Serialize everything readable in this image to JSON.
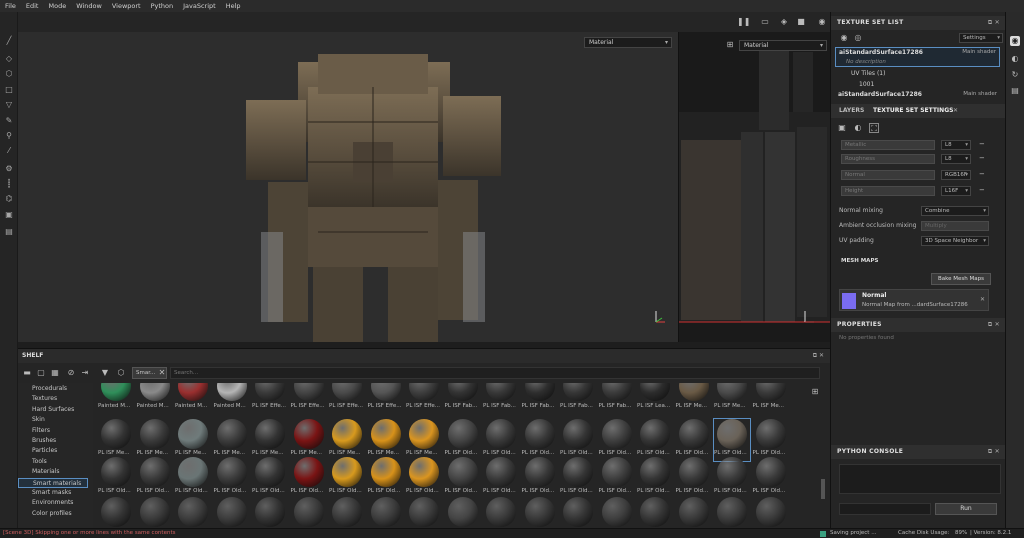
{
  "menu": [
    "File",
    "Edit",
    "Mode",
    "Window",
    "Viewport",
    "Python",
    "JavaScript",
    "Help"
  ],
  "viewport3d": {
    "mode": "Material"
  },
  "viewport2d": {
    "mode": "Material"
  },
  "texture_set_list": {
    "title": "TEXTURE SET LIST",
    "settings_label": "Settings",
    "sets": [
      {
        "name": "aiStandardSurface17286",
        "shader": "Main shader",
        "description": "No description",
        "uv_tiles": "UV Tiles (1)",
        "tile": "1001"
      },
      {
        "name": "aiStandardSurface17286",
        "shader": "Main shader"
      }
    ]
  },
  "tabs": {
    "layers": "LAYERS",
    "settings": "TEXTURE SET SETTINGS"
  },
  "channels": [
    {
      "name": "Metallic",
      "format": "L8"
    },
    {
      "name": "Roughness",
      "format": "L8"
    },
    {
      "name": "Normal",
      "format": "RGB16F"
    },
    {
      "name": "Height",
      "format": "L16F"
    }
  ],
  "mixing": [
    {
      "label": "Normal mixing",
      "value": "Combine"
    },
    {
      "label": "Ambient occlusion mixing",
      "value": "Multiply"
    },
    {
      "label": "UV padding",
      "value": "3D Space Neighbor"
    }
  ],
  "mesh_maps": {
    "title": "MESH MAPS",
    "bake_label": "Bake Mesh Maps",
    "map_name": "Normal",
    "map_desc": "Normal Map from ...dardSurface17286"
  },
  "properties": {
    "title": "PROPERTIES",
    "empty": "No properties found"
  },
  "python_console": {
    "title": "PYTHON CONSOLE",
    "run_label": "Run"
  },
  "shelf": {
    "title": "SHELF",
    "filter_tag": "Smar...",
    "search_placeholder": "Search...",
    "categories": [
      "Procedurals",
      "Textures",
      "Hard Surfaces",
      "Skin",
      "Filters",
      "Brushes",
      "Particles",
      "Tools",
      "Materials",
      "Smart materials",
      "Smart masks",
      "Environments",
      "Color profiles"
    ],
    "selected_category": "Smart materials",
    "row1": [
      {
        "label": "Painted M...",
        "color": "#2f8f5a"
      },
      {
        "label": "Painted M...",
        "color": "#8a8a8a"
      },
      {
        "label": "Painted M...",
        "color": "#9a2f2f"
      },
      {
        "label": "Painted M...",
        "color": "#b5b5b5"
      },
      {
        "label": "PL ISF Effe...",
        "color": "#3a3a3a"
      },
      {
        "label": "PL ISF Effe...",
        "color": "#444"
      },
      {
        "label": "PL ISF Effe...",
        "color": "#4a4a4a"
      },
      {
        "label": "PL ISF Effe...",
        "color": "#555"
      },
      {
        "label": "PL ISF Effe...",
        "color": "#3e3e3e"
      },
      {
        "label": "PL ISF Fab...",
        "color": "#333"
      },
      {
        "label": "PL ISF Fab...",
        "color": "#383838"
      },
      {
        "label": "PL ISF Fab...",
        "color": "#2e2e2e"
      },
      {
        "label": "PL ISF Fab...",
        "color": "#363636"
      },
      {
        "label": "PL ISF Fab...",
        "color": "#3b3b3b"
      },
      {
        "label": "PL ISF Lea...",
        "color": "#2c2c2c"
      },
      {
        "label": "PL ISF Me...",
        "color": "#6a5a45"
      },
      {
        "label": "PL ISF Me...",
        "color": "#4a4a4a"
      },
      {
        "label": "PL ISF Me...",
        "color": "#3a3a3a"
      }
    ],
    "row2": [
      {
        "label": "PL ISF Me...",
        "color": "#333"
      },
      {
        "label": "PL ISF Me...",
        "color": "#3a3a3a"
      },
      {
        "label": "PL ISF Me...",
        "color": "#6f7b7b"
      },
      {
        "label": "PL ISF Me...",
        "color": "#3c3c3c"
      },
      {
        "label": "PL ISF Me...",
        "color": "#333"
      },
      {
        "label": "PL ISF Me...",
        "color": "#7a1414"
      },
      {
        "label": "PL ISF Me...",
        "color": "#d89a1e"
      },
      {
        "label": "PL ISF Me...",
        "color": "#d8921a"
      },
      {
        "label": "PL ISF Me...",
        "color": "#da9520"
      },
      {
        "label": "PL ISF Old...",
        "color": "#444"
      },
      {
        "label": "PL ISF Old...",
        "color": "#3a3a3a"
      },
      {
        "label": "PL ISF Old...",
        "color": "#383838"
      },
      {
        "label": "PL ISF Old...",
        "color": "#343434"
      },
      {
        "label": "PL ISF Old...",
        "color": "#3e3e3e"
      },
      {
        "label": "PL ISF Old...",
        "color": "#353535"
      },
      {
        "label": "PL ISF Old...",
        "color": "#393939"
      },
      {
        "label": "PL ISF Old...",
        "color": "#6a6258"
      },
      {
        "label": "PL ISF Old...",
        "color": "#3a3a3a"
      }
    ],
    "row3": [
      {
        "label": "PL ISF Old...",
        "color": "#333"
      },
      {
        "label": "PL ISF Old...",
        "color": "#3a3a3a"
      },
      {
        "label": "PL ISF Old...",
        "color": "#6a7575"
      },
      {
        "label": "PL ISF Old...",
        "color": "#3c3c3c"
      },
      {
        "label": "PL ISF Old...",
        "color": "#333"
      },
      {
        "label": "PL ISF Old...",
        "color": "#7a1414"
      },
      {
        "label": "PL ISF Old...",
        "color": "#d89a1e"
      },
      {
        "label": "PL ISF Old...",
        "color": "#d8921a"
      },
      {
        "label": "PL ISF Old...",
        "color": "#da9520"
      },
      {
        "label": "PL ISF Old...",
        "color": "#444"
      },
      {
        "label": "PL ISF Old...",
        "color": "#3a3a3a"
      },
      {
        "label": "PL ISF Old...",
        "color": "#383838"
      },
      {
        "label": "PL ISF Old...",
        "color": "#343434"
      },
      {
        "label": "PL ISF Old...",
        "color": "#3e3e3e"
      },
      {
        "label": "PL ISF Old...",
        "color": "#353535"
      },
      {
        "label": "PL ISF Old...",
        "color": "#393939"
      },
      {
        "label": "PL ISF Old...",
        "color": "#3b3b3b"
      },
      {
        "label": "PL ISF Old...",
        "color": "#3a3a3a"
      }
    ],
    "row4_colors": [
      "#333",
      "#3a3a3a",
      "#3c3c3c",
      "#3c3c3c",
      "#333",
      "#3a3a3a",
      "#383838",
      "#3c3c3c",
      "#3a3a3a",
      "#444",
      "#3a3a3a",
      "#383838",
      "#343434",
      "#3e3e3e",
      "#353535",
      "#393939",
      "#3b3b3b",
      "#3a3a3a"
    ]
  },
  "status": {
    "message": "[Scene 3D] Skipping one or more lines with the same contents",
    "saving": "Saving project ...",
    "cache": "Cache Disk Usage:",
    "cache_value": "89%",
    "version": "| Version: 8.2.1"
  }
}
